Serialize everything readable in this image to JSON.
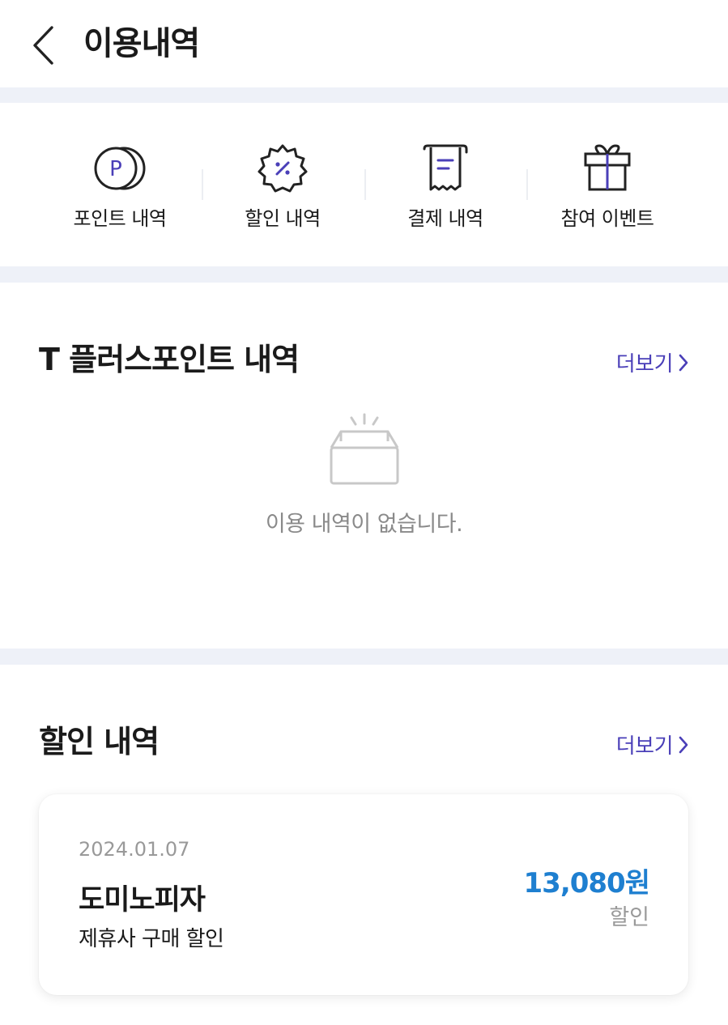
{
  "header": {
    "back_icon": "chevron-left-icon",
    "title": "이용내역"
  },
  "quick_menu": {
    "items": [
      {
        "label": "포인트 내역",
        "icon": "point-coin-icon"
      },
      {
        "label": "할인 내역",
        "icon": "discount-badge-icon"
      },
      {
        "label": "결제 내역",
        "icon": "receipt-icon"
      },
      {
        "label": "참여 이벤트",
        "icon": "gift-icon"
      }
    ]
  },
  "points_section": {
    "title": "T 플러스포인트 내역",
    "more_label": "더보기",
    "empty_icon": "empty-box-icon",
    "empty_text": "이용 내역이 없습니다."
  },
  "discount_section": {
    "title": "할인 내역",
    "more_label": "더보기",
    "items": [
      {
        "date": "2024.01.07",
        "merchant": "도미노피자",
        "description": "제휴사 구매 할인",
        "amount": "13,080원",
        "amount_label": "할인"
      }
    ]
  },
  "colors": {
    "accent": "#4a3fb8",
    "amount": "#1e7fd0",
    "divider": "#eef1f8"
  }
}
